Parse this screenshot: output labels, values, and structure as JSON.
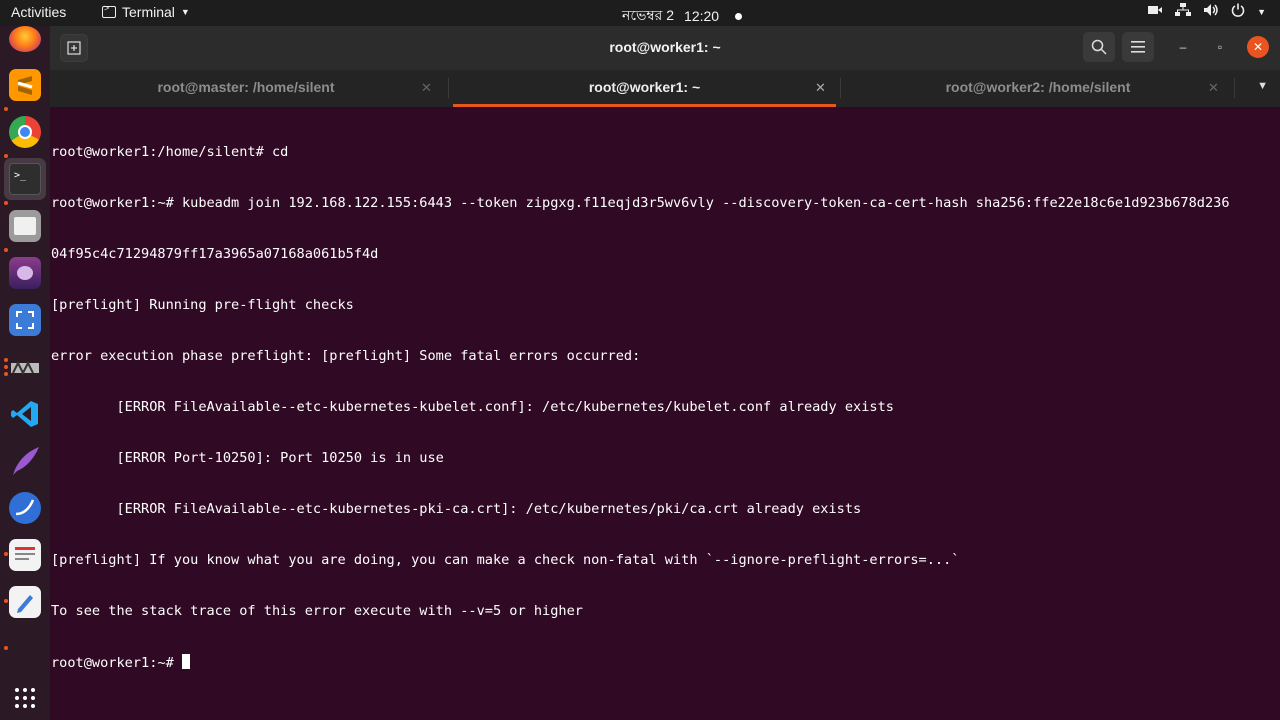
{
  "topbar": {
    "activities": "Activities",
    "app_name": "Terminal",
    "date": "নভেম্বর 2",
    "time": "12:20"
  },
  "window": {
    "title": "root@worker1: ~",
    "tabs": [
      {
        "label": "root@master: /home/silent",
        "active": false
      },
      {
        "label": "root@worker1: ~",
        "active": true
      },
      {
        "label": "root@worker2: /home/silent",
        "active": false
      }
    ]
  },
  "terminal": {
    "lines": [
      "root@worker1:/home/silent# cd",
      "root@worker1:~# kubeadm join 192.168.122.155:6443 --token zipgxg.f11eqjd3r5wv6vly --discovery-token-ca-cert-hash sha256:ffe22e18c6e1d923b678d236",
      "04f95c4c71294879ff17a3965a07168a061b5f4d",
      "[preflight] Running pre-flight checks",
      "error execution phase preflight: [preflight] Some fatal errors occurred:",
      "        [ERROR FileAvailable--etc-kubernetes-kubelet.conf]: /etc/kubernetes/kubelet.conf already exists",
      "        [ERROR Port-10250]: Port 10250 is in use",
      "        [ERROR FileAvailable--etc-kubernetes-pki-ca.crt]: /etc/kubernetes/pki/ca.crt already exists",
      "[preflight] If you know what you are doing, you can make a check non-fatal with `--ignore-preflight-errors=...`",
      "To see the stack trace of this error execute with --v=5 or higher"
    ],
    "prompt": "root@worker1:~# "
  },
  "dock": {
    "items": [
      "firefox-icon",
      "sublime-text-icon",
      "chrome-icon",
      "terminal-icon",
      "files-icon",
      "video-editor-icon",
      "screenshot-icon",
      "virt-manager-icon",
      "vscode-icon",
      "quill-icon",
      "browser-icon",
      "document-viewer-icon",
      "text-editor-icon"
    ]
  },
  "colors": {
    "terminal_bg": "#300a24",
    "accent": "#e95420"
  }
}
